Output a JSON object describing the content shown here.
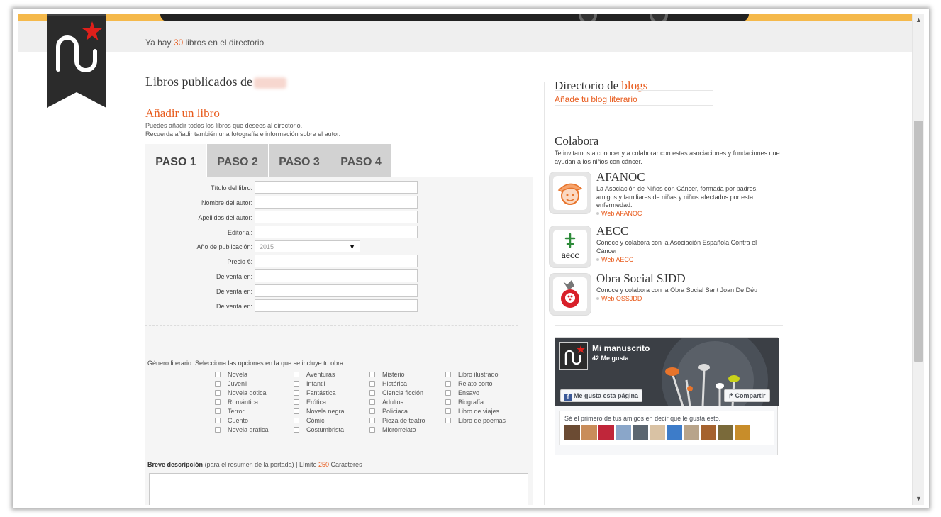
{
  "header": {
    "count_prefix": "Ya hay",
    "count_value": "30",
    "count_suffix": "libros en el directorio"
  },
  "left": {
    "published_title": "Libros publicados de",
    "add_title": "Añadir un libro",
    "add_desc_1": "Puedes añadir todos los libros que desees al directorio.",
    "add_desc_2": "Recuerda añadir también una fotografía e información sobre el autor.",
    "tabs": [
      "PASO 1",
      "PASO 2",
      "PASO 3",
      "PASO 4"
    ],
    "fields": {
      "title": "Título del libro:",
      "author_name": "Nombre del autor:",
      "author_surname": "Apellidos del autor:",
      "publisher": "Editorial:",
      "year": "Año de publicación:",
      "year_value": "2015",
      "price": "Precio €:",
      "sale_1": "De venta en:",
      "sale_2": "De venta en:",
      "sale_3": "De venta en:"
    },
    "genre_intro": "Género literario. Selecciona las opciones en la que se incluye tu obra",
    "genres": [
      [
        "Novela",
        "Juvenil",
        "Novela gótica",
        "Romántica",
        "Terror",
        "Cuento",
        "Novela gráfica"
      ],
      [
        "Aventuras",
        "Infantil",
        "Fantástica",
        "Erótica",
        "Novela negra",
        "Cómic",
        "Costumbrista"
      ],
      [
        "Misterio",
        "Histórica",
        "Ciencia ficción",
        "Adultos",
        "Policiaca",
        "Pieza de teatro",
        "Microrrelato"
      ],
      [
        "Libro ilustrado",
        "Relato corto",
        "Ensayo",
        "Biografía",
        "Libro de viajes",
        "Libro de poemas"
      ]
    ],
    "desc_label_bold": "Breve descripción",
    "desc_label_rest": "(para el resumen de la portada) | Límite",
    "desc_limit": "250",
    "desc_chars": "Caracteres"
  },
  "right": {
    "blogs_title_a": "Directorio de",
    "blogs_title_b": "blogs",
    "blogs_link": "Añade tu blog literario",
    "colabora_title": "Colabora",
    "colabora_desc": "Te invitamos a conocer y a colaborar con estas asociaciones y fundaciones que ayudan a los niños con cáncer.",
    "orgs": [
      {
        "name": "AFANOC",
        "desc": "La Asociación de Niños con Cáncer, formada por padres, amigos y familiares de niñas y niños afectados por esta enfermedad.",
        "link": "Web AFANOC"
      },
      {
        "name": "AECC",
        "desc": "Conoce y colabora con la Asociación Española Contra el Cáncer",
        "link": "Web AECC"
      },
      {
        "name": "Obra Social SJDD",
        "desc": "Conoce y colabora con la Obra Social Sant Joan De Déu",
        "link": "Web OSSJDD"
      }
    ],
    "aecc_logo_text": "aecc",
    "facebook": {
      "page_name": "Mi manuscrito",
      "likes": "42 Me gusta",
      "like_button": "Me gusta esta página",
      "share_button": "Compartir",
      "friends_text": "Sé el primero de tus amigos en decir que le gusta esto."
    }
  },
  "colors": {
    "accent": "#e85c1e",
    "hero_yellow": "#f5b94b",
    "ribbon": "#2b2b2b"
  }
}
